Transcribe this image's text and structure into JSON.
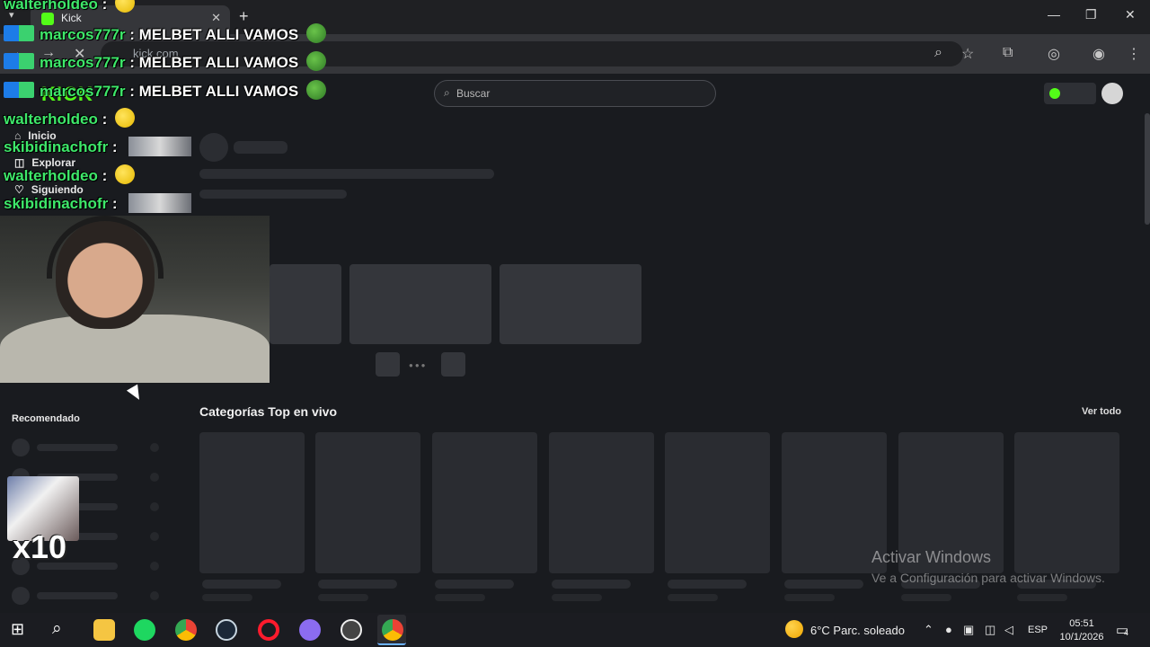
{
  "browser": {
    "tab_title": "Kick",
    "url": "kick.com",
    "new_tab_symbol": "+",
    "tab_close_symbol": "✕"
  },
  "header": {
    "logo": "KICK",
    "search_placeholder": "Buscar"
  },
  "sidebar": {
    "items": [
      {
        "label": "Inicio",
        "icon": "home-icon"
      },
      {
        "label": "Explorar",
        "icon": "compass-icon"
      },
      {
        "label": "Siguiendo",
        "icon": "heart-icon"
      }
    ],
    "recommended_title": "Recomendado"
  },
  "main": {
    "categories_title": "Categorías Top en vivo",
    "see_all": "Ver todo"
  },
  "overlay": {
    "chat": [
      {
        "user": "walterholdeo",
        "sep": ":",
        "msg": "",
        "emote": "yellow",
        "badge": false
      },
      {
        "user": "marcos777r",
        "sep": ":",
        "msg": "MELBET ALLI VAMOS",
        "emote": "pepe",
        "badge": true
      },
      {
        "user": "marcos777r",
        "sep": ":",
        "msg": "MELBET ALLI VAMOS",
        "emote": "pepe",
        "badge": true
      },
      {
        "user": "marcos777r",
        "sep": ":",
        "msg": "MELBET ALLI VAMOS",
        "emote": "pepe",
        "badge": true
      },
      {
        "user": "walterholdeo",
        "sep": ":",
        "msg": "",
        "emote": "yellow",
        "badge": false
      },
      {
        "user": "skibidinachofr",
        "sep": ":",
        "msg": "",
        "emote": "image",
        "badge": false
      },
      {
        "user": "walterholdeo",
        "sep": ":",
        "msg": "",
        "emote": "yellow",
        "badge": false
      },
      {
        "user": "skibidinachofr",
        "sep": ":",
        "msg": "",
        "emote": "image",
        "badge": false
      }
    ],
    "multiplier": "x10"
  },
  "watermark": {
    "line1": "Activar Windows",
    "line2": "Ve a Configuración para activar Windows."
  },
  "taskbar": {
    "weather": "6°C  Parc. soleado",
    "lang": "ESP",
    "time": "05:51",
    "date": "10/1/2026",
    "notif_count": "4"
  },
  "colors": {
    "kick_green": "#53fc18",
    "chat_user": "#3ee86a",
    "page_bg": "#191b1f"
  }
}
